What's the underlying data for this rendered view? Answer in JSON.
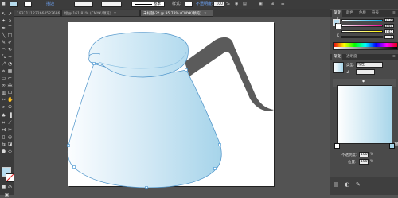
{
  "control_bar": {
    "stroke_label": "描边",
    "stroke_weight": "",
    "stroke_profile": "基本",
    "style_label": "样式:",
    "opacity_label": "不透明度:",
    "opacity_value": "100",
    "opacity_unit": "%"
  },
  "tabs": [
    {
      "label": "1937111232664523686",
      "close": "✕"
    },
    {
      "label": "未标题-2* @ 95.78% (CMYK/预览)",
      "close": "✕"
    }
  ],
  "inactive_tab_partial": "绘@ 161.81% (CMYK/预览)",
  "tools": [
    "↖",
    "↗",
    "✦",
    "✒",
    "T",
    "╲",
    "□",
    "✎",
    "✐",
    "◠",
    "↻",
    "⤡",
    "▦",
    "✂",
    "⬚",
    "◐",
    "✋",
    "🔍"
  ],
  "color_panel": {
    "tabs": [
      "渐变",
      "颜色",
      "色板",
      "符号"
    ],
    "channels": [
      {
        "label": "C",
        "value": "27.68",
        "unit": "%",
        "fill": 0.28
      },
      {
        "label": "M",
        "value": "3.46",
        "unit": "%",
        "fill": 0.04
      },
      {
        "label": "Y",
        "value": "7.45",
        "unit": "%",
        "fill": 0.07
      },
      {
        "label": "K",
        "value": "0",
        "unit": "%",
        "fill": 0
      }
    ]
  },
  "gradient_panel": {
    "tabs": [
      "渐变",
      "透明度"
    ],
    "type_label": "类型:",
    "type_value": "线性",
    "opacity_label": "不透明度:",
    "opacity_value": "100",
    "location_label": "位置:",
    "location_value": "100",
    "unit": "%"
  },
  "fill_color": "#b7dcee",
  "stroke_color": "#ffffff",
  "body_gradient": [
    "#ffffff",
    "#a9d6ea"
  ],
  "handle_color": "#5a5a5a",
  "accent_blue": "#3b8fd0"
}
